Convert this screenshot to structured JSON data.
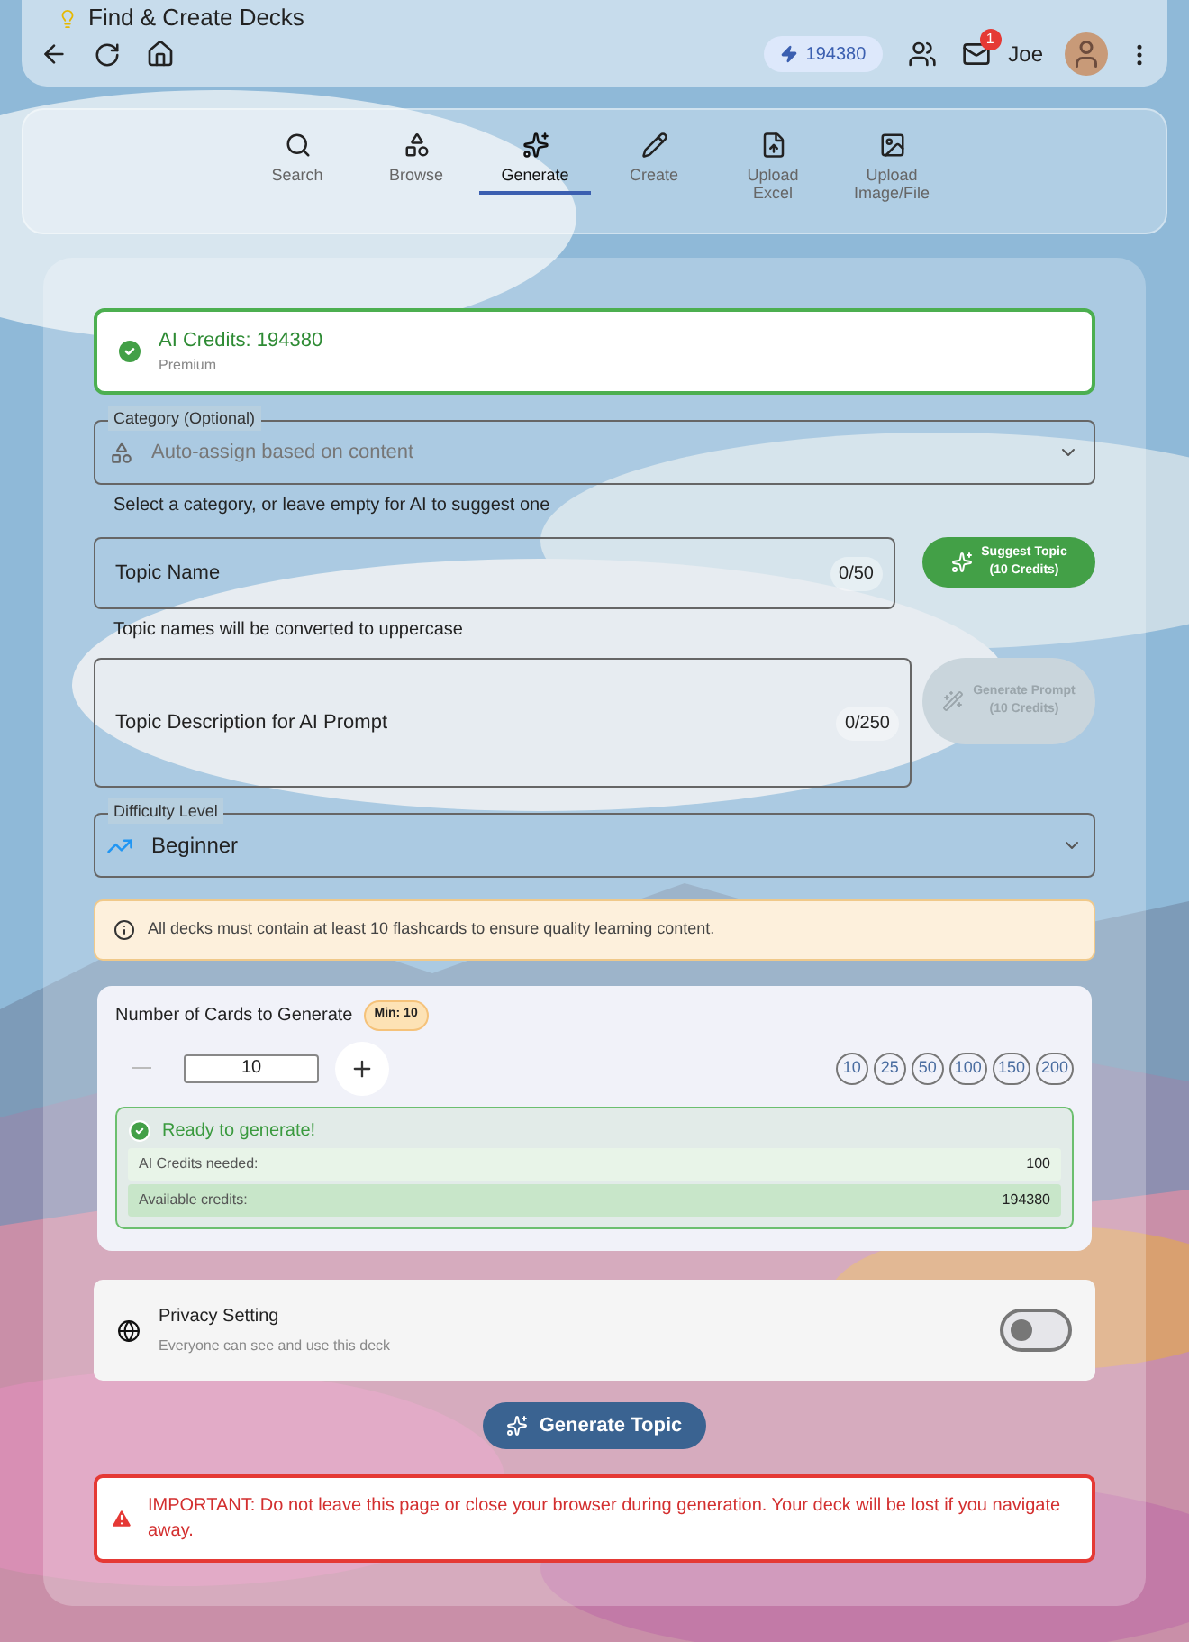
{
  "app_bar": {
    "title": "Find & Create Decks",
    "credits": "194380",
    "mail_badge": "1",
    "user": "Joe"
  },
  "nav_tabs": [
    {
      "label": "Search",
      "kind": "search",
      "selected": false
    },
    {
      "label": "Browse",
      "kind": "browse",
      "selected": false
    },
    {
      "label": "Generate",
      "kind": "generate",
      "selected": true
    },
    {
      "label": "Create",
      "kind": "create",
      "selected": false
    },
    {
      "label": "Upload Excel",
      "kind": "excel",
      "selected": false
    },
    {
      "label": "Upload Image/File",
      "kind": "file",
      "selected": false
    }
  ],
  "credits_card": {
    "title": "AI Credits: 194380",
    "subtitle": "Premium"
  },
  "category": {
    "label": "Category (Optional)",
    "placeholder": "Auto-assign based on content",
    "helper": "Select a category, or leave empty for AI to suggest one"
  },
  "topic_name": {
    "placeholder": "Topic Name",
    "counter": "0/50",
    "helper": "Topic names will be converted to uppercase",
    "button": {
      "label": "Suggest Topic",
      "sublabel": "(10 Credits)",
      "disabled": false
    }
  },
  "topic_description": {
    "placeholder": "Topic Description for AI Prompt",
    "counter": "0/250",
    "button": {
      "label": "Generate Prompt",
      "sublabel": "(10 Credits)",
      "disabled": true
    }
  },
  "difficulty": {
    "label": "Difficulty Level",
    "value": "Beginner"
  },
  "notice": "All decks must contain at least 10 flashcards to ensure quality learning content.",
  "cards": {
    "title": "Number of Cards to Generate",
    "min_badge": "Min: 10",
    "value": "10",
    "decrement_disabled": true,
    "presets": [
      "10",
      "25",
      "50",
      "100",
      "150",
      "200"
    ],
    "status": {
      "title": "Ready to generate!",
      "rows": [
        {
          "label": "AI Credits needed:",
          "value": "100"
        },
        {
          "label": "Available credits:",
          "value": "194380"
        }
      ]
    }
  },
  "privacy": {
    "title": "Privacy Setting",
    "subtitle": "Everyone can see and use this deck",
    "on": false
  },
  "generate_button": "Generate Topic",
  "warning": "IMPORTANT: Do not leave this page or close your browser during generation. Your deck will be lost if you navigate away."
}
